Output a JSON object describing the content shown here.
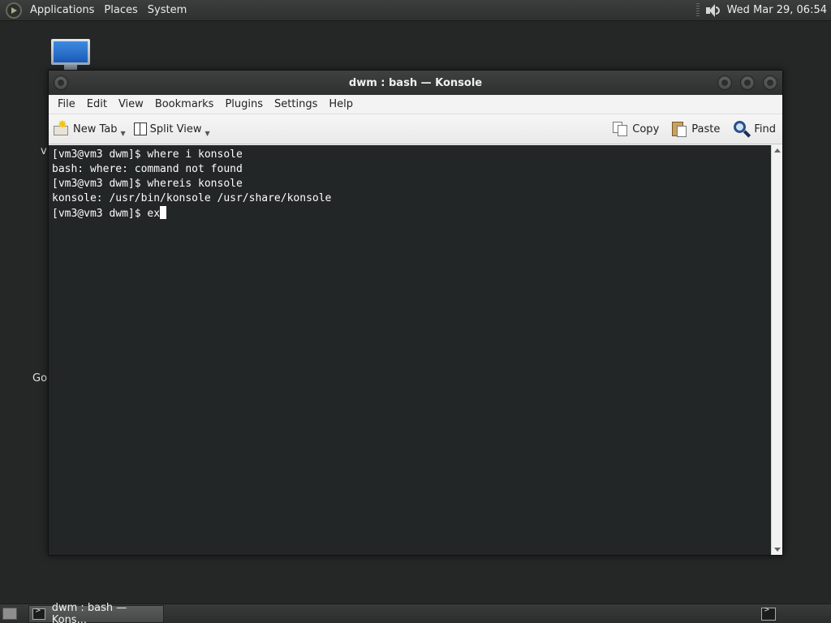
{
  "top_panel": {
    "menus": [
      "Applications",
      "Places",
      "System"
    ],
    "clock": "Wed Mar 29, 06:54"
  },
  "desktop": {
    "partial_labels": [
      "v",
      "Go"
    ]
  },
  "window": {
    "title": "dwm : bash — Konsole",
    "menu": [
      "File",
      "Edit",
      "View",
      "Bookmarks",
      "Plugins",
      "Settings",
      "Help"
    ],
    "toolbar": {
      "new_tab": "New Tab",
      "split_view": "Split View",
      "copy": "Copy",
      "paste": "Paste",
      "find": "Find"
    }
  },
  "terminal": {
    "lines": [
      "[vm3@vm3 dwm]$ where i konsole",
      "bash: where: command not found",
      "[vm3@vm3 dwm]$ whereis konsole",
      "konsole: /usr/bin/konsole /usr/share/konsole",
      "[vm3@vm3 dwm]$ ex"
    ]
  },
  "taskbar": {
    "task_label": "dwm : bash — Kons..."
  },
  "colors": {
    "terminal_bg": "#232627",
    "terminal_fg": "#fcfcfc",
    "panel_bg": "#2f3030",
    "desktop_bg": "#252626"
  }
}
